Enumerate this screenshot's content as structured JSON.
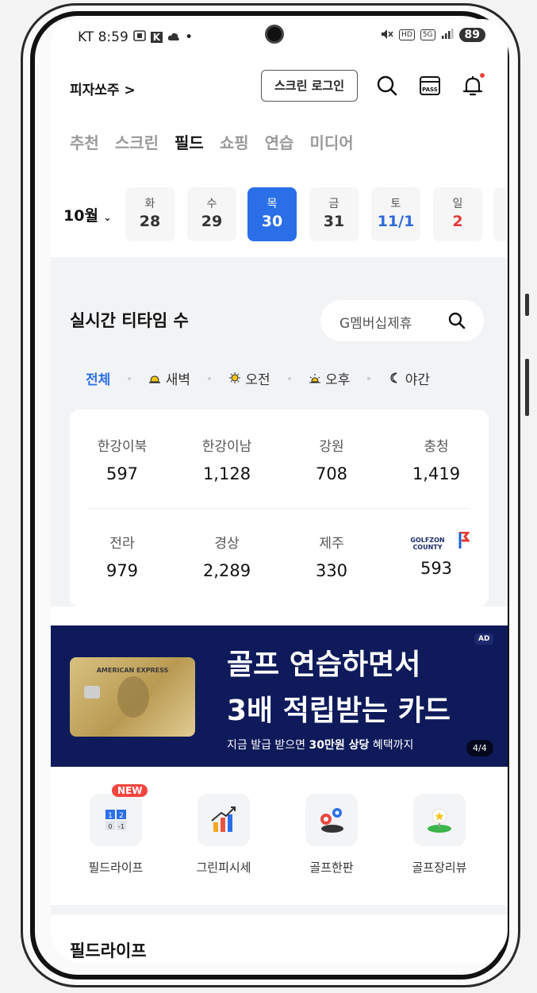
{
  "status_bar": {
    "carrier_time": "KT 8:59",
    "battery": "89",
    "hd_label": "HD",
    "net_label": "5G"
  },
  "header": {
    "brand": "피자쏘주 >",
    "login_button": "스크린 로그인",
    "pass_label": "PASS"
  },
  "tabs": [
    {
      "label": "추천",
      "active": false
    },
    {
      "label": "스크린",
      "active": false
    },
    {
      "label": "필드",
      "active": true
    },
    {
      "label": "쇼핑",
      "active": false
    },
    {
      "label": "연습",
      "active": false
    },
    {
      "label": "미디어",
      "active": false
    }
  ],
  "date_picker": {
    "month": "10월",
    "days": [
      {
        "weekday": "화",
        "day": "28"
      },
      {
        "weekday": "수",
        "day": "29"
      },
      {
        "weekday": "목",
        "day": "30",
        "selected": true
      },
      {
        "weekday": "금",
        "day": "31"
      },
      {
        "weekday": "토",
        "day": "11/1"
      },
      {
        "weekday": "일",
        "day": "2"
      }
    ]
  },
  "tee_time": {
    "title": "실시간 티타임 수",
    "search_placeholder": "G멤버십제휴",
    "filters": [
      "전체",
      "새벽",
      "오전",
      "오후",
      "야간"
    ],
    "regions": [
      {
        "name": "한강이북",
        "count": "597"
      },
      {
        "name": "한강이남",
        "count": "1,128"
      },
      {
        "name": "강원",
        "count": "708"
      },
      {
        "name": "충청",
        "count": "1,419"
      },
      {
        "name": "전라",
        "count": "979"
      },
      {
        "name": "경상",
        "count": "2,289"
      },
      {
        "name": "제주",
        "count": "330"
      },
      {
        "name": "GOLFZON COUNTY",
        "count": "593"
      }
    ]
  },
  "ad": {
    "badge": "AD",
    "line1": "골프 연습하면서",
    "line2": "3배 적립받는 카드",
    "line3_pre": "지금 발급 받으면 ",
    "line3_bold": "30만원 상당",
    "line3_post": " 혜택까지",
    "counter": "4/4",
    "card_label": "AMERICAN EXPRESS"
  },
  "quick_menu": [
    {
      "label": "필드라이프",
      "badge": "NEW",
      "icon": "scoreboard-icon"
    },
    {
      "label": "그린피시세",
      "icon": "bar-chart-icon"
    },
    {
      "label": "골프한판",
      "icon": "golf-chips-icon"
    },
    {
      "label": "골프장리뷰",
      "icon": "golf-course-star-icon"
    }
  ],
  "fieldlife_title": "필드라이프",
  "colors": {
    "accent": "#2b6fe8",
    "ad_bg": "#0e1a5a",
    "new_badge": "#f2463f",
    "sunday": "#e23a3a",
    "saturday": "#2f6ad9"
  }
}
